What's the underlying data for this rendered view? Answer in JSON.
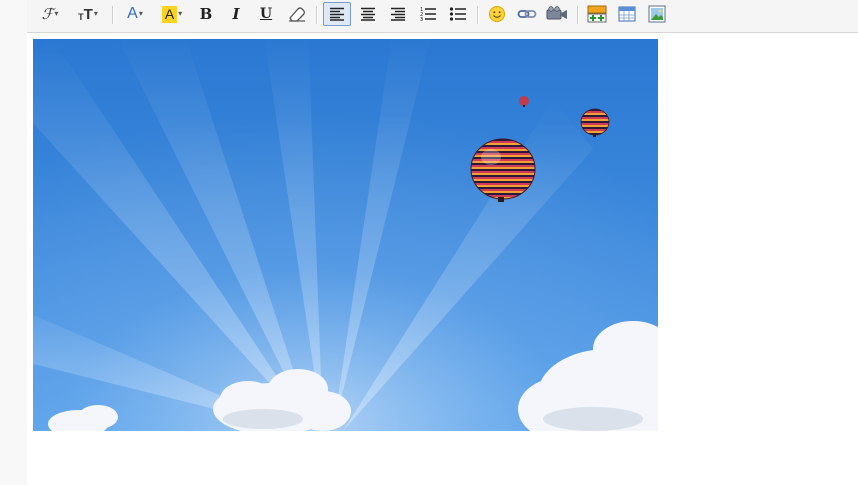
{
  "toolbar": {
    "groups": [
      [
        "font-family-button",
        "font-size-button"
      ],
      [
        "font-color-button",
        "highlight-color-button",
        "bold-button",
        "italic-button",
        "underline-button",
        "clear-format-button"
      ],
      [
        "align-left-button",
        "align-center-button",
        "align-right-button",
        "ordered-list-button",
        "unordered-list-button"
      ],
      [
        "emoticon-button",
        "link-button",
        "video-button"
      ],
      [
        "insert-row-button",
        "table-button",
        "image-button"
      ]
    ],
    "active_button": "align-left-button",
    "glyphs": {
      "font_family": "ℱ",
      "font_size_small": "T",
      "font_size_large": "T",
      "font_color": "A",
      "highlight": "A",
      "bold": "B",
      "italic": "I",
      "underline": "U",
      "caret": "▾"
    },
    "colors": {
      "font_color": "#2f6bcd",
      "highlight_bg": "#ffd21f",
      "active_bg": "#dfe9f6",
      "active_border": "#7a9cc8"
    }
  },
  "content": {
    "image": {
      "description_icon": "photo-hot-air-balloons",
      "sky_top": "#2a78d2",
      "sky_bottom": "#4f9be8"
    }
  }
}
